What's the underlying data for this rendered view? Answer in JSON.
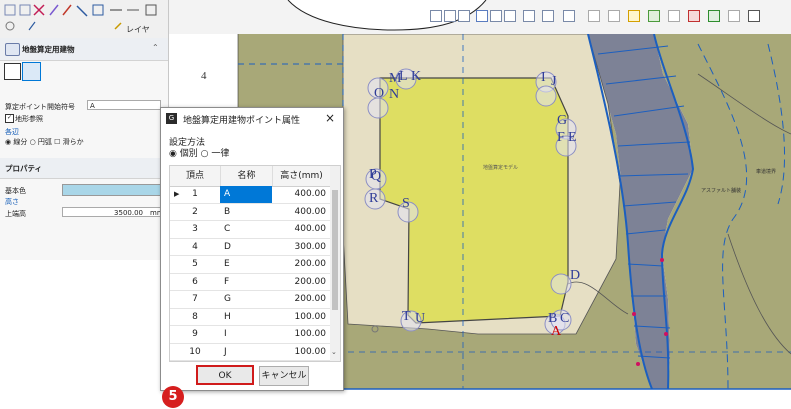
{
  "toolbar_left": {
    "layer_label": "レイヤ"
  },
  "panel": {
    "title": "地盤算定用建物",
    "start_label": "算定ポイント開始符号",
    "start_value": "A",
    "terrain_ref": "地形参照",
    "edge_label": "各辺",
    "edge_options": [
      "線分",
      "円弧",
      "滑らか"
    ],
    "props_title": "プロパティ",
    "base_color_label": "基本色",
    "height_label": "高さ",
    "top_label": "上端高",
    "top_value": "3500.00",
    "top_unit": "mm"
  },
  "canvas": {
    "number_label": "4",
    "center_text": "地盤算定モデル",
    "asphalt_text": "アスファルト舗装",
    "road_text": "車道境界"
  },
  "dialog": {
    "title": "地盤算定用建物ポイント属性",
    "close": "×",
    "method_label": "設定方法",
    "method_options": [
      "個別",
      "一律"
    ],
    "col_vertex": "頂点",
    "col_name": "名称",
    "col_height": "高さ(mm)",
    "rows": [
      {
        "no": "1",
        "name": "A",
        "h": "400.00"
      },
      {
        "no": "2",
        "name": "B",
        "h": "400.00"
      },
      {
        "no": "3",
        "name": "C",
        "h": "400.00"
      },
      {
        "no": "4",
        "name": "D",
        "h": "300.00"
      },
      {
        "no": "5",
        "name": "E",
        "h": "200.00"
      },
      {
        "no": "6",
        "name": "F",
        "h": "200.00"
      },
      {
        "no": "7",
        "name": "G",
        "h": "200.00"
      },
      {
        "no": "8",
        "name": "H",
        "h": "100.00"
      },
      {
        "no": "9",
        "name": "I",
        "h": "100.00"
      },
      {
        "no": "10",
        "name": "J",
        "h": "100.00"
      }
    ],
    "ok_label": "OK",
    "cancel_label": "キャンセル"
  },
  "step_badge": "5",
  "point_labels": [
    "M",
    "K",
    "N",
    "O",
    "L",
    "I",
    "J",
    "G",
    "F",
    "E",
    "P",
    "Q",
    "R",
    "S",
    "D",
    "T",
    "U",
    "B",
    "C",
    "A"
  ],
  "colors": {
    "building": "#dede62",
    "terrain": "#a8a878",
    "road": "#7d8296",
    "accent": "#0078d7",
    "highlight": "#e00000",
    "badge": "#d61e1e"
  }
}
